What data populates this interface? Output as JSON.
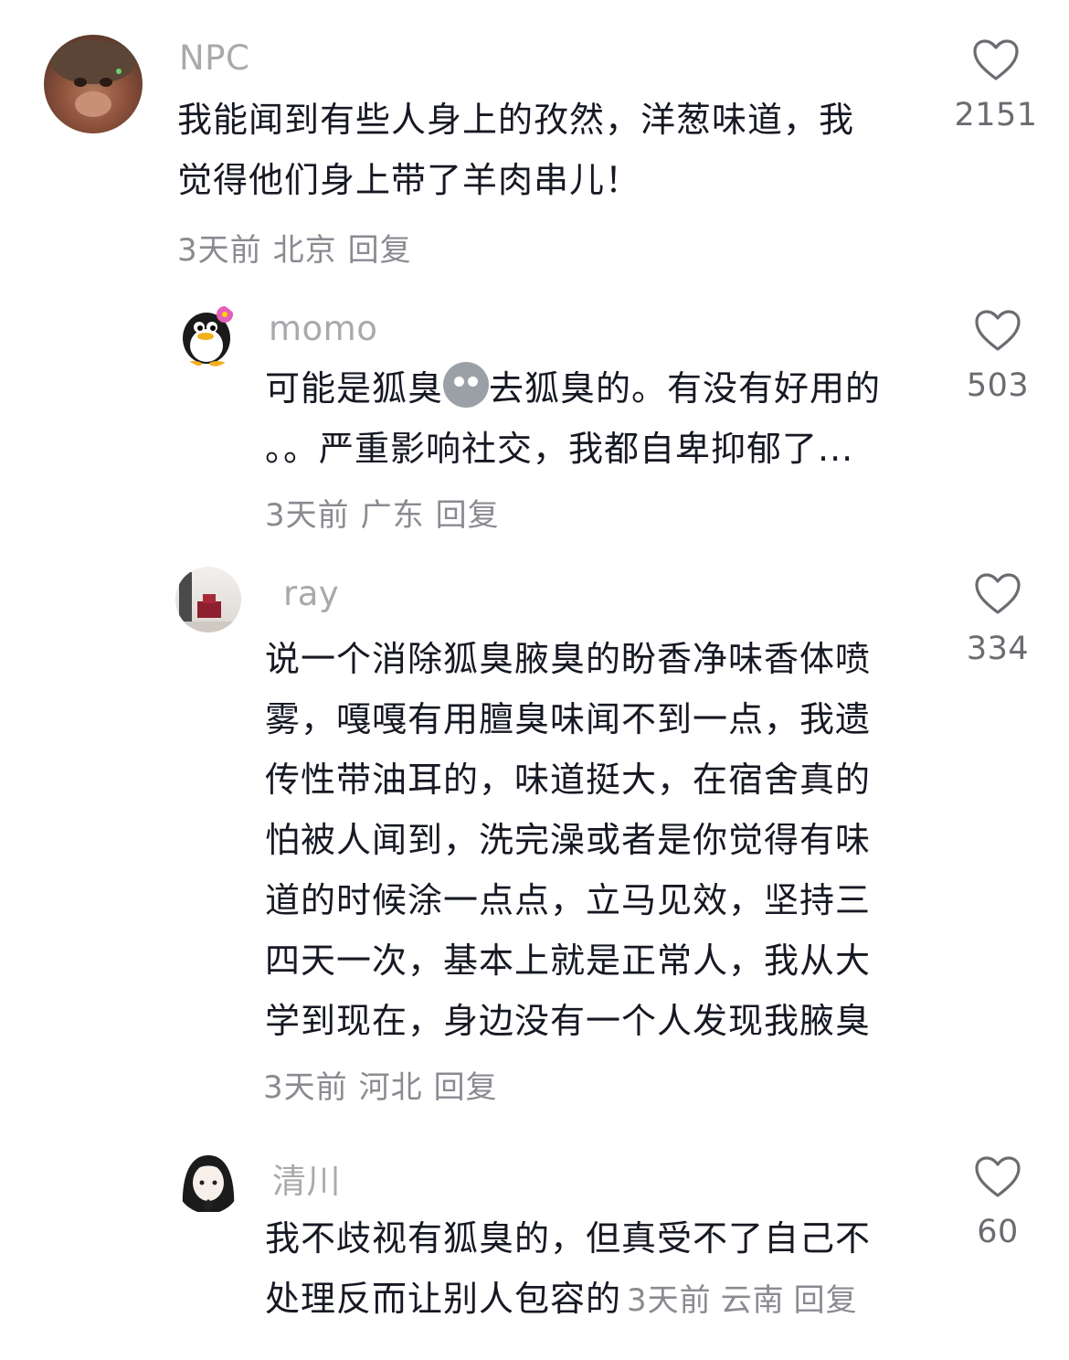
{
  "comments": [
    {
      "username": "NPC",
      "avatar": "monkey-face-avatar",
      "lines": [
        "我能闻到有些人身上的孜然，洋葱味道，我",
        "觉得他们身上带了羊肉串儿！"
      ],
      "time": "3天前",
      "location": "北京",
      "reply": "回复",
      "likes": "2151"
    },
    {
      "username": "momo",
      "avatar": "penguin-avatar",
      "line1_before": "可能是狐臭",
      "emoji": "sad-face-emoji",
      "line1_after": "去狐臭的。有没有好用的",
      "line2": "。。严重影响社交，我都自卑抑郁了...",
      "time": "3天前",
      "location": "广东",
      "reply": "回复",
      "likes": "503"
    },
    {
      "username": "ray",
      "avatar": "room-photo-avatar",
      "lines": [
        "说一个消除狐臭腋臭的盼香净味香体喷",
        "雾，嘎嘎有用膻臭味闻不到一点，我遗",
        "传性带油耳的，味道挺大，在宿舍真的",
        "怕被人闻到，洗完澡或者是你觉得有味",
        "道的时候涂一点点，立马见效，坚持三",
        "四天一次，基本上就是正常人，我从大",
        "学到现在，身边没有一个人发现我腋臭"
      ],
      "time": "3天前",
      "location": "河北",
      "reply": "回复",
      "likes": "334"
    },
    {
      "username": "清川",
      "avatar": "anime-girl-avatar",
      "lines": [
        "我不歧视有狐臭的，但真受不了自己不",
        "处理反而让别人包容的"
      ],
      "time": "3天前",
      "location": "云南",
      "reply": "回复",
      "likes": "60"
    }
  ],
  "icons": {
    "like": "heart-outline-icon"
  },
  "colors": {
    "text": "#161823",
    "username": "#a9a9ad",
    "meta": "#8a8b91"
  }
}
